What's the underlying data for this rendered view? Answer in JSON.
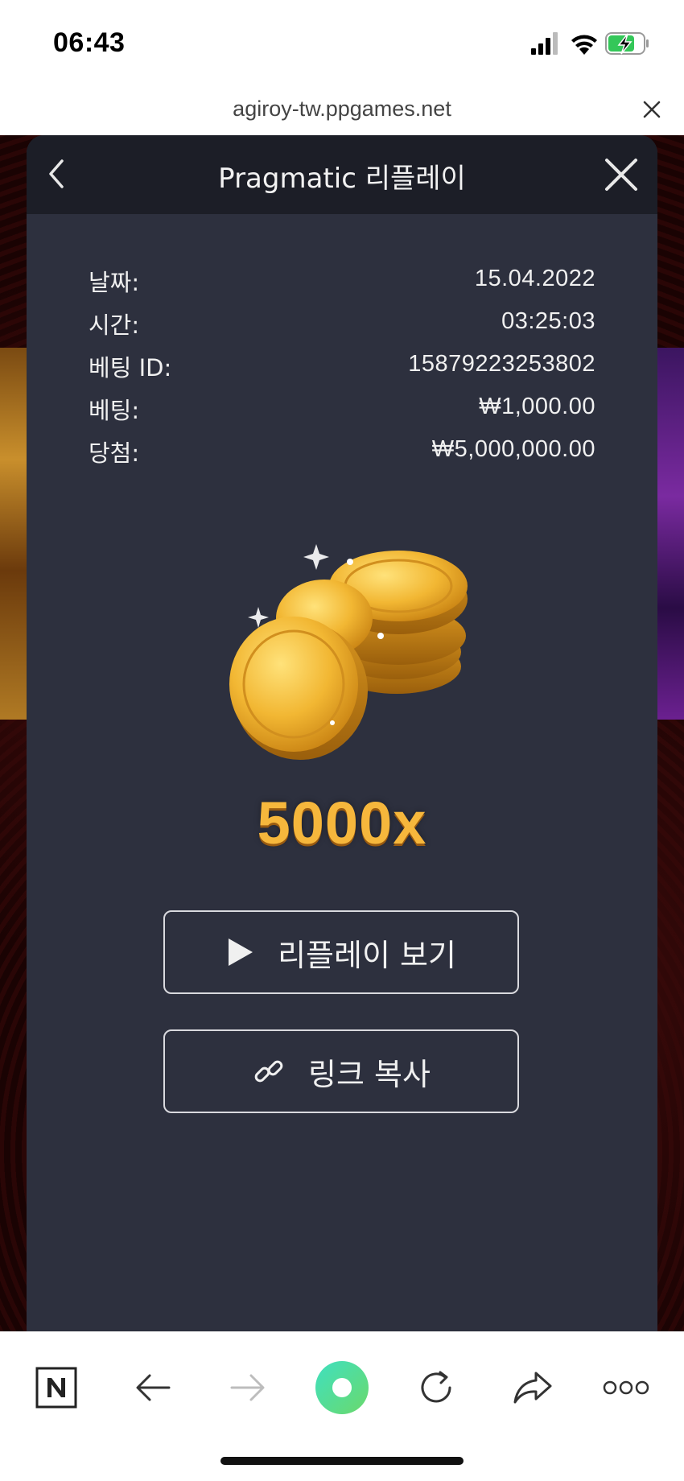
{
  "status_bar": {
    "time": "06:43",
    "icons": [
      "signal-icon",
      "wifi-icon",
      "battery-charging-icon"
    ]
  },
  "url_bar": {
    "url": "agiroy-tw.ppgames.net",
    "close_icon": "close-icon"
  },
  "modal": {
    "title": "Pragmatic 리플레이",
    "back_icon": "chevron-left-icon",
    "close_icon": "close-icon",
    "info": [
      {
        "label": "날짜:",
        "value": "15.04.2022"
      },
      {
        "label": "시간:",
        "value": "03:25:03"
      },
      {
        "label": "베팅 ID:",
        "value": "15879223253802"
      },
      {
        "label": "베팅:",
        "value": "₩1,000.00"
      },
      {
        "label": "당첨:",
        "value": "₩5,000,000.00"
      }
    ],
    "multiplier": "5000x",
    "replay_button": {
      "label": "리플레이 보기",
      "icon": "play-icon"
    },
    "copy_link_button": {
      "label": "링크 복사",
      "icon": "link-icon"
    }
  },
  "toolbar": {
    "items": [
      "naver-home-icon",
      "back-arrow-icon",
      "forward-arrow-icon",
      "green-dot-icon",
      "reload-icon",
      "share-icon",
      "more-icon"
    ]
  },
  "colors": {
    "modal_bg": "#2d303e",
    "header_bg": "#1c1e27",
    "gold": "#f6b73c",
    "green_button": "#3fd99a"
  }
}
